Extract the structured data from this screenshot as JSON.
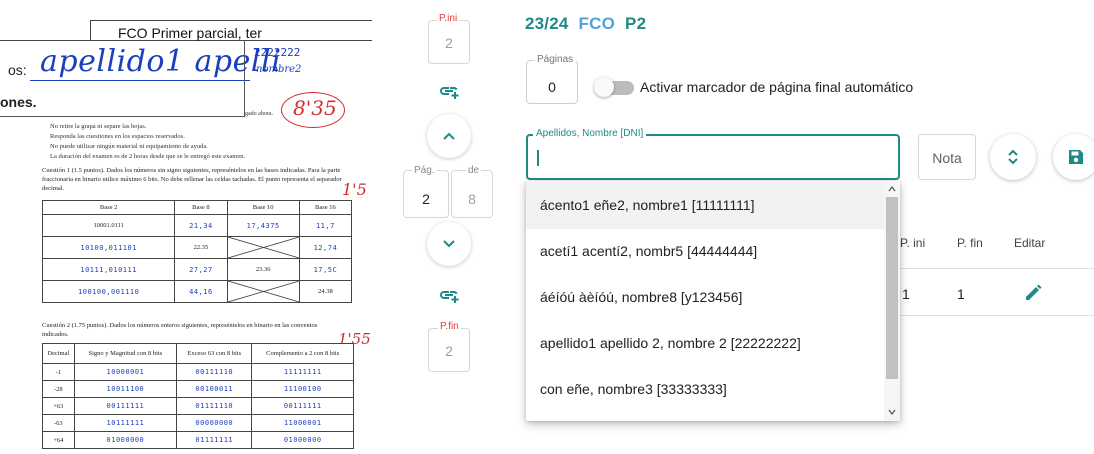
{
  "exam_scan": {
    "header_title": "FCO Primer parcial, ter",
    "name_prefix": "os:",
    "handwritten_name": "apellido1 apelli",
    "handwritten_number": "2222222",
    "handwritten_nombre": "nombre2",
    "section_label": "ones.",
    "ahora": "gado ahora.",
    "grade": "8'35",
    "rules": [
      "No retire la grapa ni separe las hojas.",
      "Responda las cuestiones en los espacios reservados.",
      "No puede utilizar ningún material ni equipamiento de ayuda.",
      "La duración del examen es de 2 horas desde que se le entregó este examen."
    ],
    "q1_text": "Cuestión 1 (1.5 puntos). Dados los números sin signo siguientes, represéntelos en las bases indicadas. Para la parte fraccionaria en binario utilice máximo 6 bits. No debe rellenar las celdas tachadas. El punto representa el separador decimal.",
    "q1_mark": "1'5",
    "table1": {
      "headers": [
        "Base 2",
        "Base 8",
        "Base 10",
        "Base 16"
      ],
      "rows": [
        [
          "10001.0111",
          "21,34",
          "17,4375",
          "11,7"
        ],
        [
          "10100,011101",
          "22.35",
          "",
          "12,74"
        ],
        [
          "10111,010111",
          "27,27",
          "23.36",
          "17,5C"
        ],
        [
          "100100,001110",
          "44,16",
          "",
          "24.38"
        ]
      ]
    },
    "q2_text": "Cuestión 2 (1.75 puntos). Dados los números enteros siguientes, represéntelos en binario en las convenios indicados.",
    "q2_mark": "1'55",
    "table2": {
      "headers": [
        "Decimal",
        "Signo y Magnitud con 8 bits",
        "Exceso 63 con 8 bits",
        "Complemento a 2 con 8 bits"
      ],
      "rows": [
        [
          "-1",
          "10000001",
          "00111110",
          "11111111"
        ],
        [
          "-28",
          "10011100",
          "00100011",
          "11100100"
        ],
        [
          "+63",
          "00111111",
          "01111110",
          "00111111"
        ],
        [
          "-63",
          "10111111",
          "00000000",
          "11000001"
        ],
        [
          "+64",
          "01000000",
          "01111111",
          "01000000"
        ]
      ]
    }
  },
  "nav": {
    "pini_label": "P.ini",
    "pini_value": "2",
    "pag_label": "Pág.",
    "pag_value": "2",
    "de_label": "de",
    "de_value": "8",
    "pfin_label": "P.fin",
    "pfin_value": "2"
  },
  "panel": {
    "title_part1": "23/24",
    "title_part2": "FCO",
    "title_part3": "P2",
    "paginas_label": "Páginas",
    "paginas_value": "0",
    "toggle_label": "Activar marcador de página final automático",
    "name_label": "Apellidos, Nombre [DNI]",
    "name_value": "",
    "nota_placeholder": "Nota"
  },
  "table_behind": {
    "headers": [
      "P. ini",
      "P. fin",
      "Editar"
    ],
    "row": [
      "1",
      "1"
    ]
  },
  "dropdown": {
    "items": [
      "ácento1 eñe2, nombre1 [11111111]",
      "acetí1 acentí2, nombr5 [44444444]",
      "áéíóú àèíóú, nombre8 [y123456]",
      "apellido1 apellido 2, nombre 2 [22222222]",
      "con eñe, nombre3 [33333333]"
    ],
    "highlighted_index": 0
  },
  "colors": {
    "teal": "#1e8a88",
    "blue": "#4fa3d9",
    "red": "#e53935",
    "ink_blue": "#1a3fbf",
    "ink_red": "#d62a2a"
  }
}
